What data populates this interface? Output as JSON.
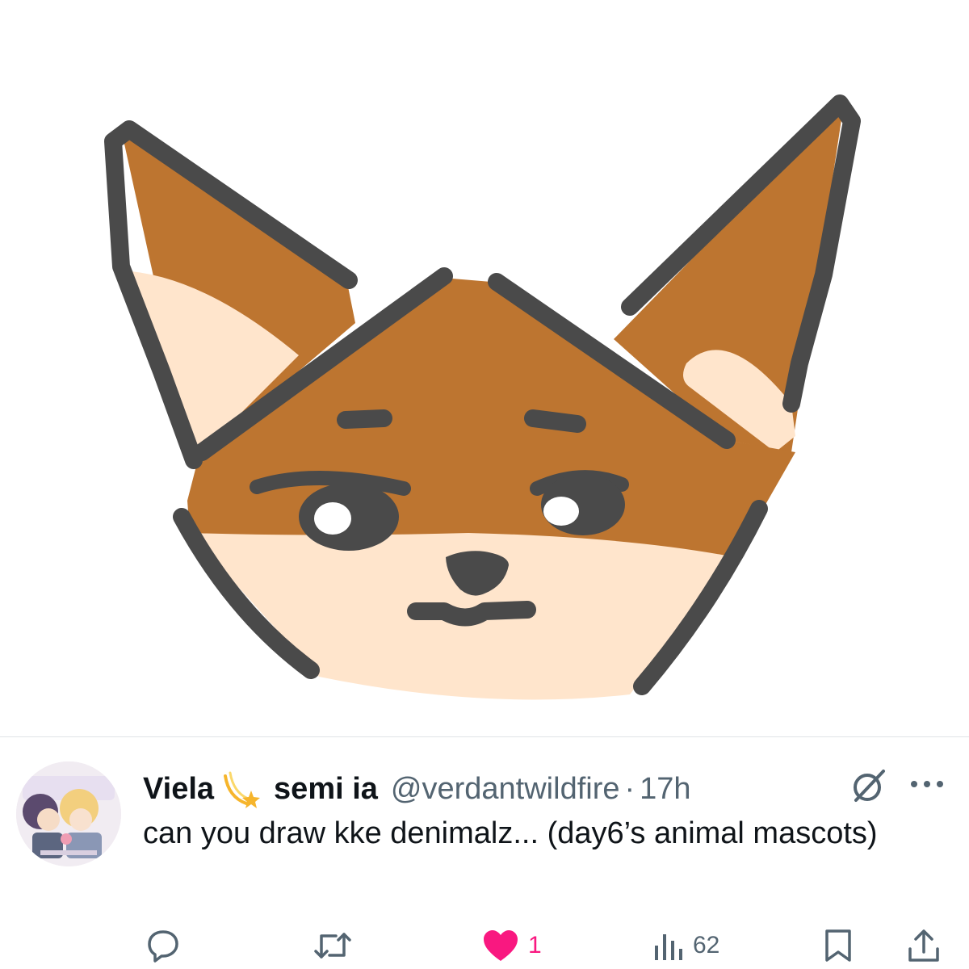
{
  "image": {
    "subject": "fox-mascot-drawing",
    "colors": {
      "fur": "#bd7530",
      "cream": "#ffe5cc",
      "outline": "#4a4a4a",
      "eye_highlight": "#ffffff"
    }
  },
  "tweet": {
    "display_name": "Viela",
    "name_emoji": "dizzy-star",
    "display_name_suffix": "semi ia",
    "handle": "@verdantwildfire",
    "separator": "·",
    "time": "17h",
    "text": "can you draw kke denimalz... (day6’s animal mascots)",
    "actions": {
      "reply_count": "",
      "retweet_count": "",
      "like_count": "1",
      "liked": true,
      "views_count": "62"
    }
  },
  "colors": {
    "text": "#0f1419",
    "secondary": "#536471",
    "like": "#f91880",
    "divider": "#dfe3e6"
  }
}
